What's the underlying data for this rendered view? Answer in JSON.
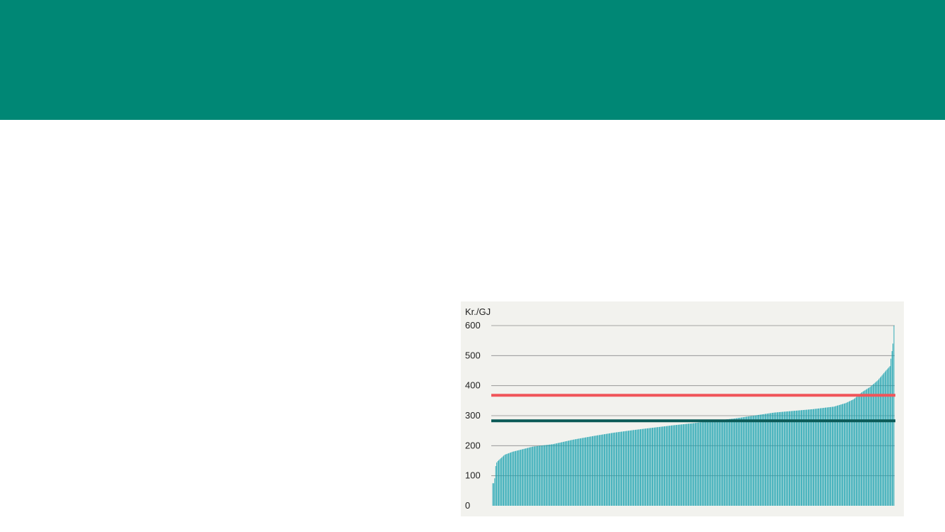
{
  "colors": {
    "header": "#008775",
    "panel": "#f2f2ee",
    "bars": "#1aa2b0",
    "upper_line": "#f0555a",
    "lower_line": "#0b5a57",
    "grid": "#8a8a8a"
  },
  "chart_data": {
    "type": "bar",
    "ylabel": "Kr./GJ",
    "ylim": [
      0,
      600
    ],
    "yticks": [
      0,
      100,
      200,
      300,
      400,
      500,
      600
    ],
    "grid": true,
    "sorted_ascending": true,
    "bar_count": 400,
    "value_profile": {
      "x_fraction": [
        0,
        0.004,
        0.008,
        0.012,
        0.03,
        0.05,
        0.08,
        0.1,
        0.15,
        0.2,
        0.25,
        0.3,
        0.35,
        0.4,
        0.45,
        0.5,
        0.55,
        0.6,
        0.65,
        0.7,
        0.75,
        0.8,
        0.85,
        0.88,
        0.9,
        0.92,
        0.94,
        0.96,
        0.98,
        0.99,
        0.9975,
        1.0
      ],
      "value": [
        75,
        75,
        140,
        148,
        170,
        180,
        190,
        197,
        205,
        220,
        232,
        243,
        252,
        260,
        268,
        275,
        283,
        290,
        300,
        310,
        316,
        322,
        330,
        342,
        355,
        378,
        395,
        418,
        450,
        465,
        540,
        600
      ]
    },
    "reference_lines": [
      {
        "value": 368,
        "color": "#f0555a"
      },
      {
        "value": 283,
        "color": "#0b5a57"
      }
    ]
  }
}
